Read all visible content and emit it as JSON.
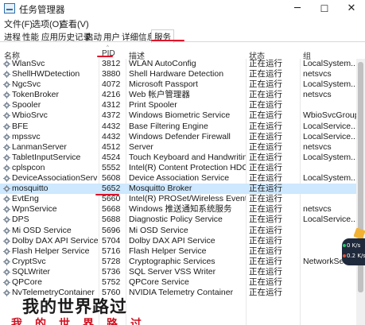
{
  "window": {
    "title": "任务管理器",
    "min_glyph": "─",
    "max_glyph": "☐",
    "close_glyph": "✕"
  },
  "menu": [
    "文件(F)",
    "选项(O)",
    "查看(V)"
  ],
  "tabs": [
    "进程",
    "性能",
    "应用历史记录",
    "启动",
    "用户",
    "详细信息",
    "服务"
  ],
  "active_tab": "服务",
  "columns": {
    "name": "名称",
    "pid": "PID",
    "desc": "描述",
    "status": "状态",
    "group": "组"
  },
  "sort_indicator": "^",
  "rows": [
    {
      "name": "WlanSvc",
      "pid": "3812",
      "desc": "WLAN AutoConfig",
      "status": "正在运行",
      "group": "LocalSystem..."
    },
    {
      "name": "ShellHWDetection",
      "pid": "3880",
      "desc": "Shell Hardware Detection",
      "status": "正在运行",
      "group": "netsvcs"
    },
    {
      "name": "NgcSvc",
      "pid": "4072",
      "desc": "Microsoft Passport",
      "status": "正在运行",
      "group": "LocalSystem..."
    },
    {
      "name": "TokenBroker",
      "pid": "4216",
      "desc": "Web 帐户管理器",
      "status": "正在运行",
      "group": "netsvcs"
    },
    {
      "name": "Spooler",
      "pid": "4312",
      "desc": "Print Spooler",
      "status": "正在运行",
      "group": ""
    },
    {
      "name": "WbioSrvc",
      "pid": "4372",
      "desc": "Windows Biometric Service",
      "status": "正在运行",
      "group": "WbioSvcGroup"
    },
    {
      "name": "BFE",
      "pid": "4432",
      "desc": "Base Filtering Engine",
      "status": "正在运行",
      "group": "LocalService..."
    },
    {
      "name": "mpssvc",
      "pid": "4432",
      "desc": "Windows Defender Firewall",
      "status": "正在运行",
      "group": "LocalService..."
    },
    {
      "name": "LanmanServer",
      "pid": "4512",
      "desc": "Server",
      "status": "正在运行",
      "group": "netsvcs"
    },
    {
      "name": "TabletInputService",
      "pid": "4524",
      "desc": "Touch Keyboard and Handwriting...",
      "status": "正在运行",
      "group": "LocalSystem..."
    },
    {
      "name": "cplspcon",
      "pid": "5552",
      "desc": "Intel(R) Content Protection HDCP ...",
      "status": "正在运行",
      "group": ""
    },
    {
      "name": "DeviceAssociationService",
      "pid": "5608",
      "desc": "Device Association Service",
      "status": "正在运行",
      "group": "LocalSystem..."
    },
    {
      "name": "mosquitto",
      "pid": "5652",
      "desc": "Mosquitto Broker",
      "status": "正在运行",
      "group": "",
      "selected": true
    },
    {
      "name": "EvtEng",
      "pid": "5660",
      "desc": "Intel(R) PROSet/Wireless Event Log",
      "status": "正在运行",
      "group": ""
    },
    {
      "name": "WpnService",
      "pid": "5668",
      "desc": "Windows 推送通知系统服务",
      "status": "正在运行",
      "group": "netsvcs"
    },
    {
      "name": "DPS",
      "pid": "5688",
      "desc": "Diagnostic Policy Service",
      "status": "正在运行",
      "group": "LocalService..."
    },
    {
      "name": "Mi OSD Service",
      "pid": "5696",
      "desc": "Mi OSD Service",
      "status": "正在运行",
      "group": ""
    },
    {
      "name": "Dolby DAX API Service",
      "pid": "5704",
      "desc": "Dolby DAX API Service",
      "status": "正在运行",
      "group": ""
    },
    {
      "name": "Flash Helper Service",
      "pid": "5716",
      "desc": "Flash Helper Service",
      "status": "正在运行",
      "group": ""
    },
    {
      "name": "CryptSvc",
      "pid": "5728",
      "desc": "Cryptographic Services",
      "status": "正在运行",
      "group": "NetworkServic..."
    },
    {
      "name": "SQLWriter",
      "pid": "5736",
      "desc": "SQL Server VSS Writer",
      "status": "正在运行",
      "group": ""
    },
    {
      "name": "QPCore",
      "pid": "5752",
      "desc": "QPCore Service",
      "status": "正在运行",
      "group": ""
    },
    {
      "name": "NvTelemetryContainer",
      "pid": "5760",
      "desc": "NVIDIA Telemetry Container",
      "status": "正在运行",
      "group": ""
    }
  ],
  "net_widget": {
    "up": "0 K/s",
    "down": "0.2 K/s"
  },
  "watermark": "我的世界路过",
  "watermark_sub": "我的世界路过"
}
